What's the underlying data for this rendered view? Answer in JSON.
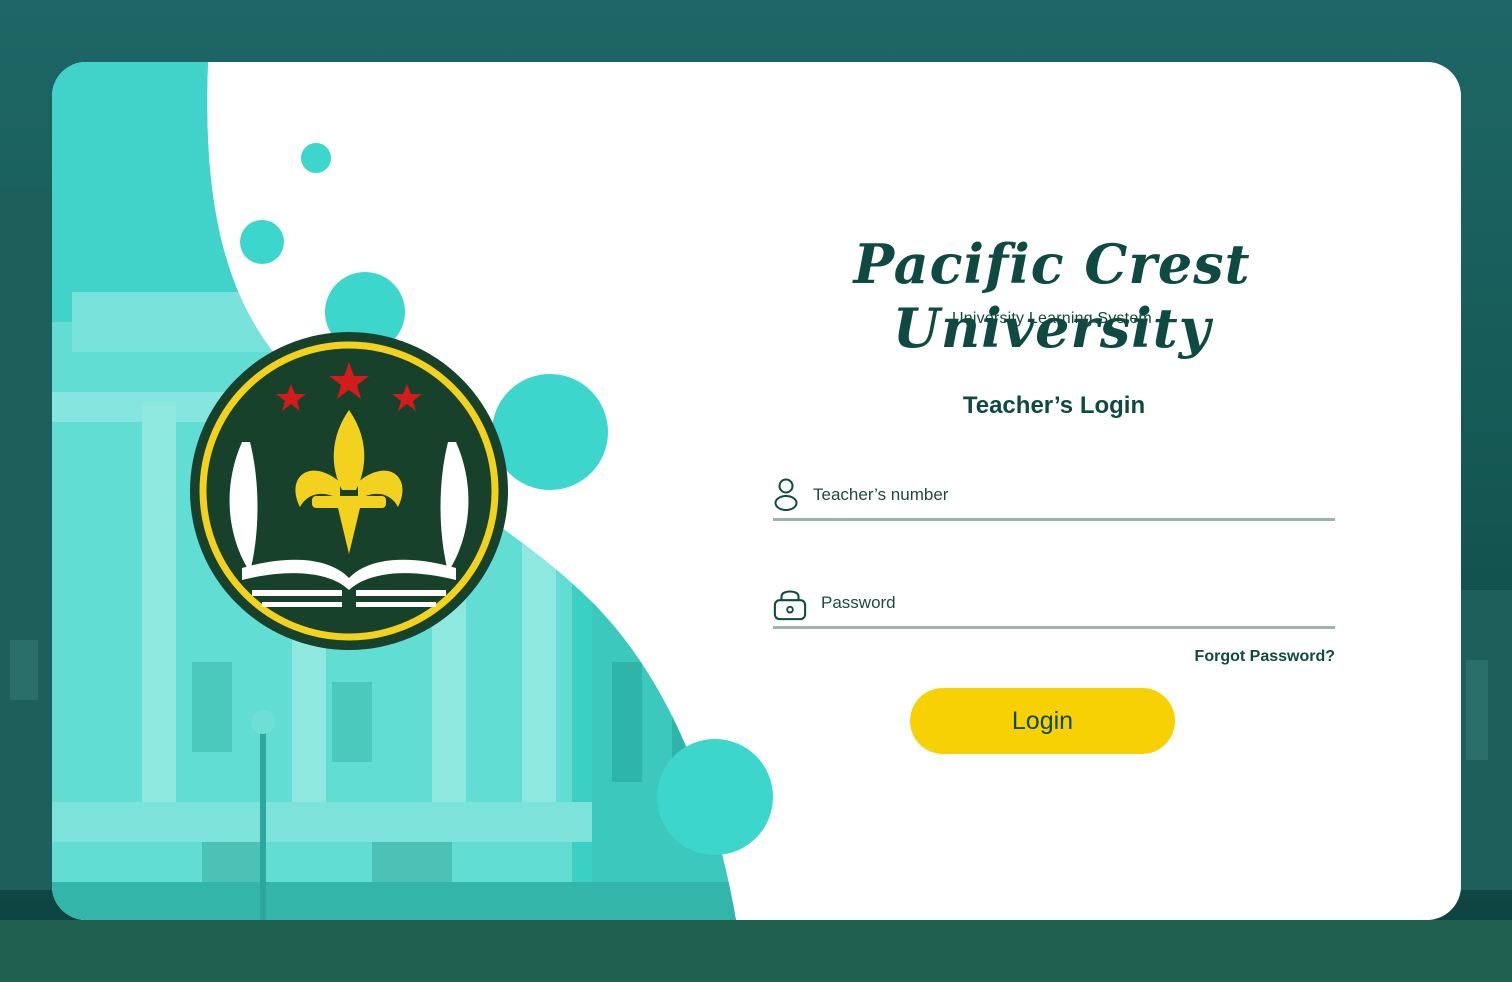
{
  "university": {
    "name": "Pacific Crest University",
    "subtitle": "University Learning System"
  },
  "login_form": {
    "heading": "Teacher’s Login",
    "teacher_number_placeholder": "Teacher’s number",
    "password_placeholder": "Password",
    "forgot_password_label": "Forgot Password?",
    "login_button_label": "Login"
  },
  "icons": {
    "user": "user-icon",
    "lock": "lock-icon",
    "crest": "university-crest"
  },
  "colors": {
    "primary_dark": "#0f4a42",
    "teal_accent": "#3dd6cc",
    "button_yellow": "#f7d104",
    "crest_green": "#17412a",
    "crest_gold": "#f2d11f",
    "crest_red": "#d21b1b"
  }
}
